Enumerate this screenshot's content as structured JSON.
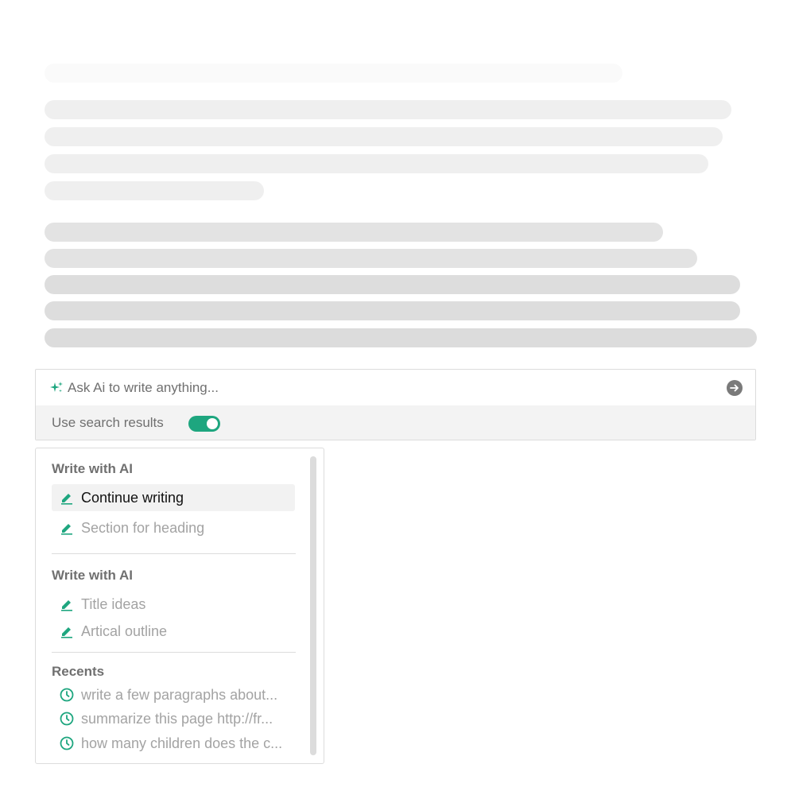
{
  "ai_prompt": {
    "placeholder": "Ask Ai to write anything...",
    "toggle_label": "Use search results",
    "toggle_on": true,
    "accent_color": "#1ea67f"
  },
  "menu": {
    "section1": {
      "title": "Write with AI",
      "items": [
        "Continue writing",
        "Section for heading"
      ]
    },
    "section2": {
      "title": "Write with AI",
      "items": [
        "Title ideas",
        "Artical outline"
      ]
    },
    "recents": {
      "title": "Recents",
      "items": [
        "write a few paragraphs about...",
        "summarize this page http://fr...",
        "how many children does the c..."
      ]
    }
  }
}
